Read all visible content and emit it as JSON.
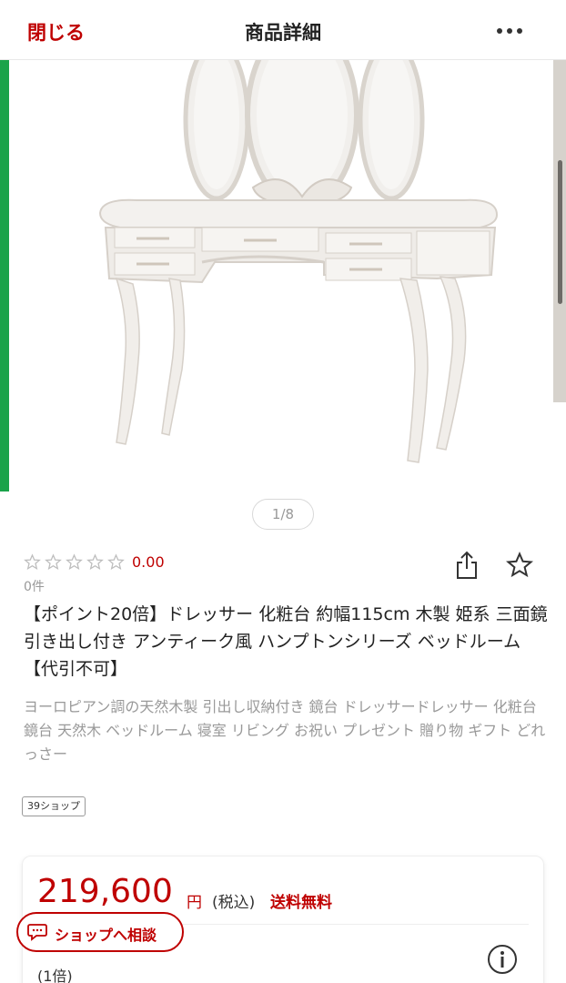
{
  "header": {
    "close_label": "閉じる",
    "title": "商品詳細",
    "more_icon": "more-horizontal-icon"
  },
  "gallery": {
    "indicator": "1/8",
    "current_index": 1,
    "total": 8
  },
  "rating": {
    "stars_filled": 0,
    "stars_total": 5,
    "value": "0.00",
    "review_count": "0件"
  },
  "actions": {
    "share_icon": "share-icon",
    "favorite_icon": "star-icon"
  },
  "product": {
    "title": "【ポイント20倍】ドレッサー 化粧台 約幅115cm 木製 姫系 三面鏡 引き出し付き アンティーク風 ハンプトンシリーズ ベッドルーム【代引不可】",
    "catch_copy": "ヨーロピアン調の天然木製 引出し収納付き 鏡台 ドレッサードレッサー 化粧台 鏡台 天然木 ベッドルーム 寝室 リビング お祝い プレゼント 贈り物 ギフト どれっさー",
    "shop_tag": "39ショップ"
  },
  "price": {
    "amount": "219,600",
    "currency": "円",
    "tax": "(税込)",
    "shipping": "送料無料",
    "points": "(1倍)"
  },
  "consult": {
    "label": "ショップへ相談",
    "icon": "chat-icon"
  },
  "colors": {
    "accent": "#bf0000",
    "side_bar": "#1aa34a",
    "muted_text": "#999999"
  }
}
